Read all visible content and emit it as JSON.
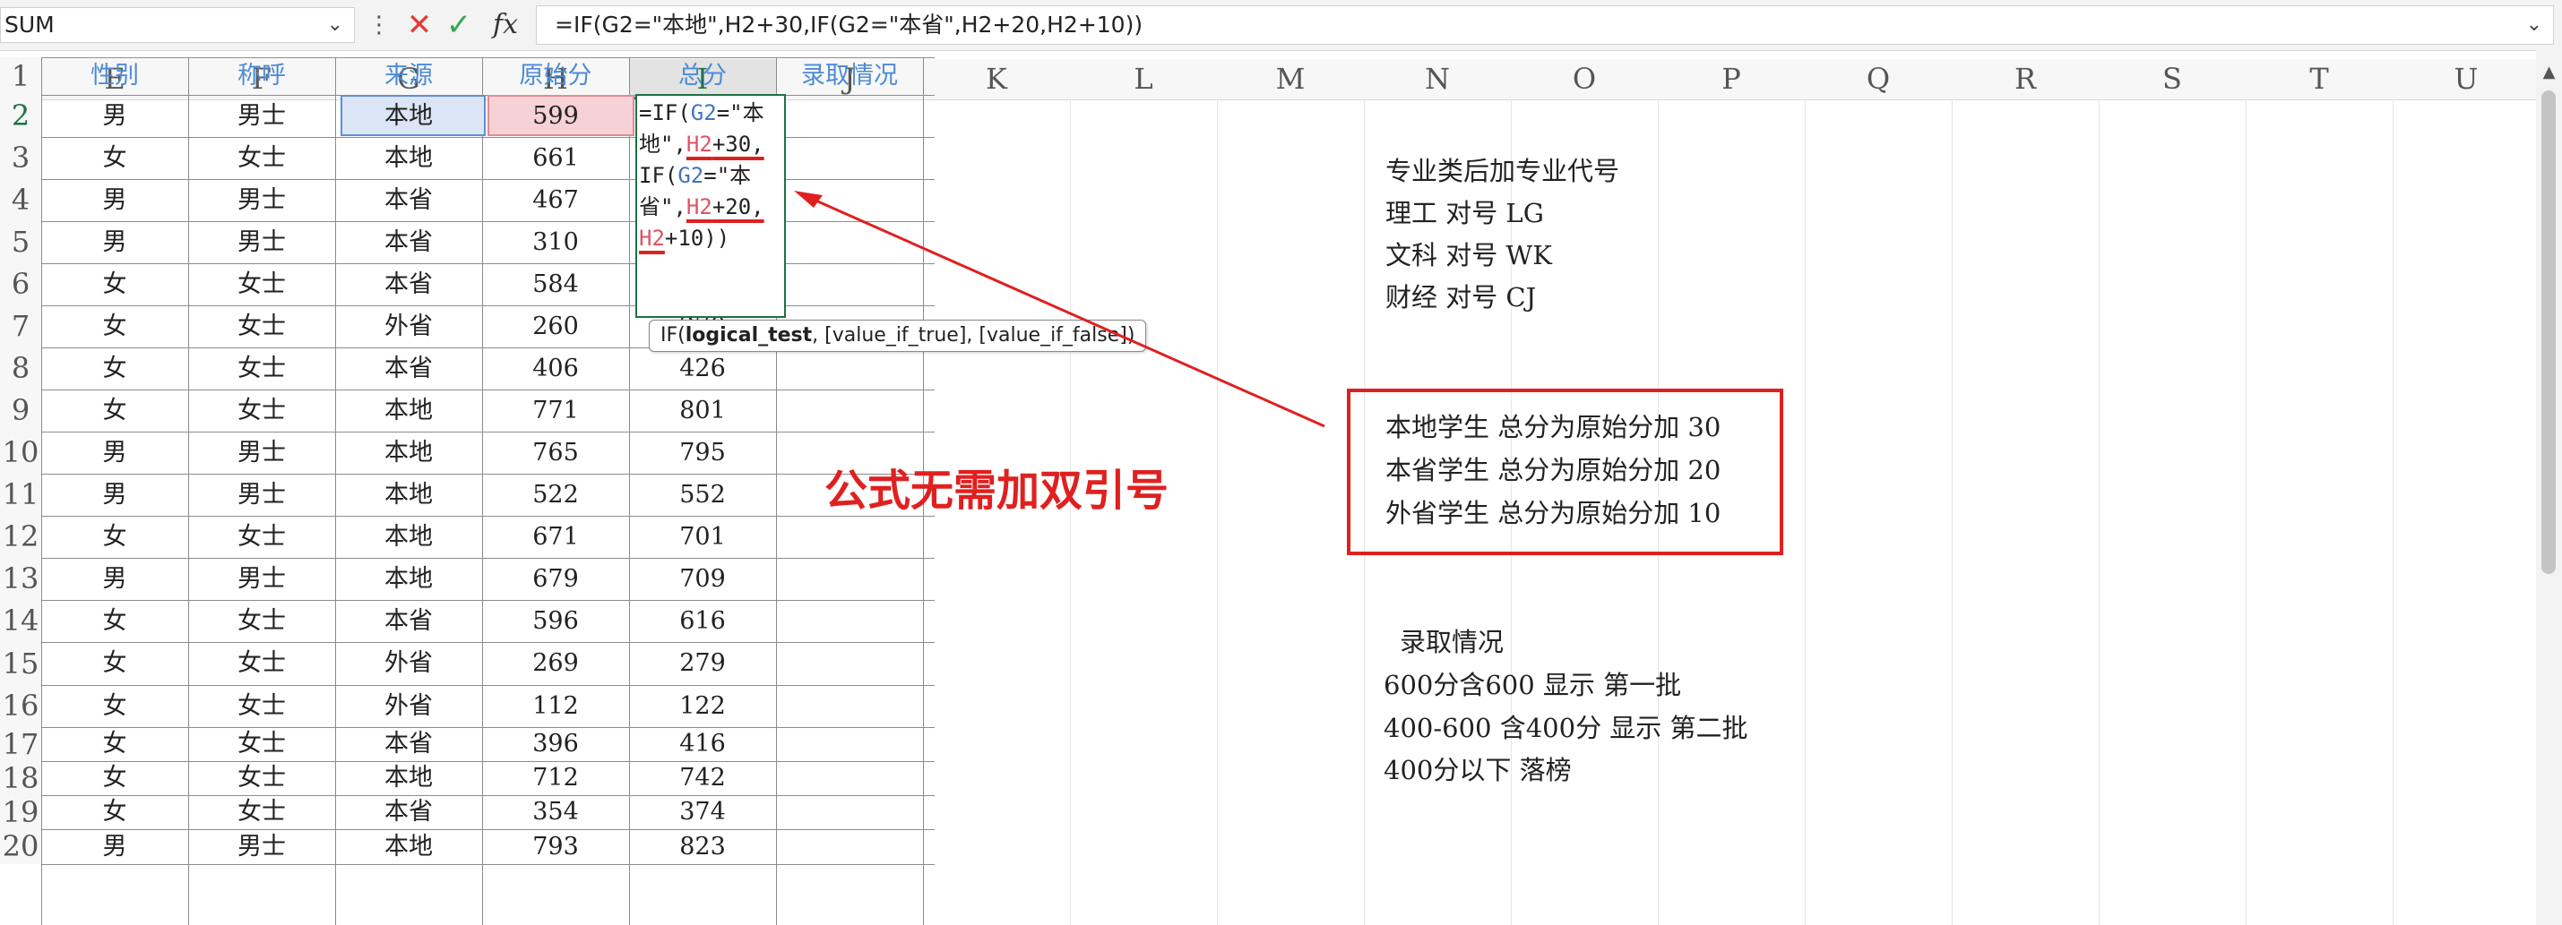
{
  "formula_bar": {
    "name_box": "SUM",
    "formula": "=IF(G2=\"本地\",H2+30,IF(G2=\"本省\",H2+20,H2+10))",
    "fx_label": "fx"
  },
  "columns": [
    "E",
    "F",
    "G",
    "H",
    "I",
    "J",
    "K",
    "L",
    "M",
    "N",
    "O",
    "P",
    "Q",
    "R",
    "S",
    "T",
    "U"
  ],
  "selected_column": "I",
  "header_row": {
    "row": "1",
    "gender": "性别",
    "title": "称呼",
    "source": "来源",
    "raw_score": "原始分",
    "total": "总分",
    "admission": "录取情况"
  },
  "rows": [
    {
      "row": "2",
      "gender": "男",
      "title": "男士",
      "source": "本地",
      "raw": "599",
      "total": ""
    },
    {
      "row": "3",
      "gender": "女",
      "title": "女士",
      "source": "本地",
      "raw": "661",
      "total": ""
    },
    {
      "row": "4",
      "gender": "男",
      "title": "男士",
      "source": "本省",
      "raw": "467",
      "total": ""
    },
    {
      "row": "5",
      "gender": "男",
      "title": "男士",
      "source": "本省",
      "raw": "310",
      "total": ""
    },
    {
      "row": "6",
      "gender": "女",
      "title": "女士",
      "source": "本省",
      "raw": "584",
      "total": ""
    },
    {
      "row": "7",
      "gender": "女",
      "title": "女士",
      "source": "外省",
      "raw": "260",
      "total": "270"
    },
    {
      "row": "8",
      "gender": "女",
      "title": "女士",
      "source": "本省",
      "raw": "406",
      "total": "426"
    },
    {
      "row": "9",
      "gender": "女",
      "title": "女士",
      "source": "本地",
      "raw": "771",
      "total": "801"
    },
    {
      "row": "10",
      "gender": "男",
      "title": "男士",
      "source": "本地",
      "raw": "765",
      "total": "795"
    },
    {
      "row": "11",
      "gender": "男",
      "title": "男士",
      "source": "本地",
      "raw": "522",
      "total": "552"
    },
    {
      "row": "12",
      "gender": "女",
      "title": "女士",
      "source": "本地",
      "raw": "671",
      "total": "701"
    },
    {
      "row": "13",
      "gender": "男",
      "title": "男士",
      "source": "本地",
      "raw": "679",
      "total": "709"
    },
    {
      "row": "14",
      "gender": "女",
      "title": "女士",
      "source": "本省",
      "raw": "596",
      "total": "616"
    },
    {
      "row": "15",
      "gender": "女",
      "title": "女士",
      "source": "外省",
      "raw": "269",
      "total": "279"
    },
    {
      "row": "16",
      "gender": "女",
      "title": "女士",
      "source": "外省",
      "raw": "112",
      "total": "122"
    },
    {
      "row": "17",
      "gender": "女",
      "title": "女士",
      "source": "本省",
      "raw": "396",
      "total": "416"
    },
    {
      "row": "18",
      "gender": "女",
      "title": "女士",
      "source": "本地",
      "raw": "712",
      "total": "742"
    },
    {
      "row": "19",
      "gender": "女",
      "title": "女士",
      "source": "本省",
      "raw": "354",
      "total": "374"
    },
    {
      "row": "20",
      "gender": "男",
      "title": "男士",
      "source": "本地",
      "raw": "793",
      "total": "823"
    }
  ],
  "editor": {
    "l1_a": "=IF(",
    "l1_b": "G2",
    "l1_c": "=\"本",
    "l2_a": "地\",",
    "l2_b": "H2",
    "l2_c": "+30,",
    "l3_a": "IF(",
    "l3_b": "G2",
    "l3_c": "=\"本",
    "l4_a": "省\",",
    "l4_b": "H2",
    "l4_c": "+20,",
    "l5_a": "H2",
    "l5_b": "+10))"
  },
  "tooltip": {
    "prefix": "IF(",
    "bold_arg": "logical_test",
    "rest": ", [value_if_true], [value_if_false])"
  },
  "notes": {
    "n1": "专业类后加专业代号",
    "n2": "理工  对号    LG",
    "n3": "文科  对号   WK",
    "n4": "财经  对号   CJ",
    "box1": "本地学生  总分为原始分加  30",
    "box2": "本省学生  总分为原始分加  20",
    "box3": "外省学生  总分为原始分加  10",
    "adm_title": "录取情况",
    "adm1": "600分含600      显示    第一批",
    "adm2": "400-600  含400分       显示    第二批",
    "adm3": "400分以下              落榜"
  },
  "annotation": "公式无需加双引号",
  "colors": {
    "accent_green": "#1e7145",
    "annotation_red": "#e02020",
    "header_blue": "#4d8bd6",
    "ref_blue": "#4472c4",
    "ref_red": "#e05363"
  }
}
